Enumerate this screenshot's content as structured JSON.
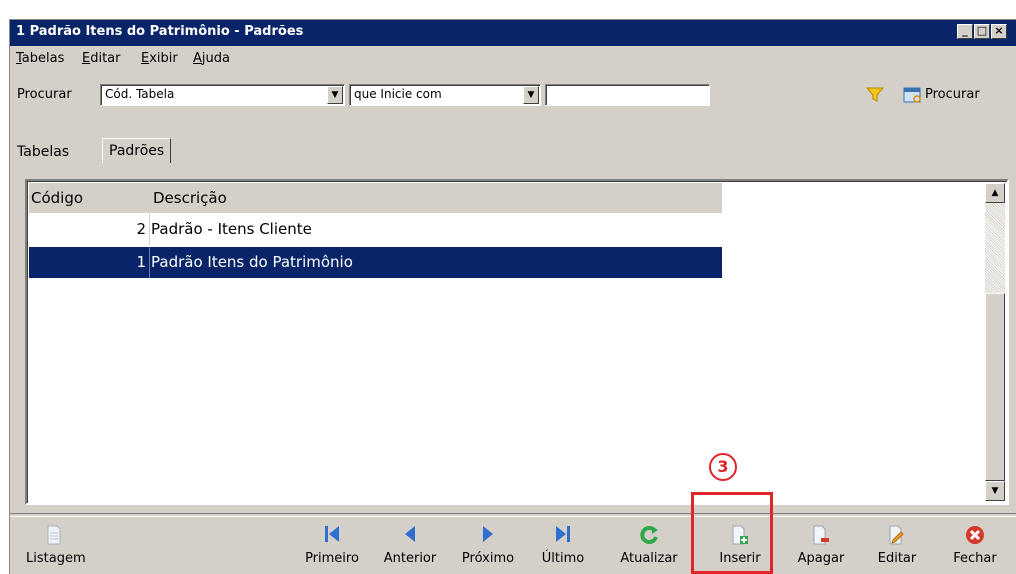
{
  "window": {
    "title": "1 Padrão Itens do Patrimônio - Padrões"
  },
  "menu": {
    "items": [
      "Tabelas",
      "Editar",
      "Exibir",
      "Ajuda"
    ]
  },
  "search": {
    "label": "Procurar",
    "field_value": "Cód. Tabela",
    "condition_value": "que Inicie com",
    "query_value": "",
    "filter_icon": "filter-icon",
    "button_label": "Procurar"
  },
  "tabs": [
    {
      "label": "Tabelas",
      "active": false
    },
    {
      "label": "Padrões",
      "active": true
    }
  ],
  "grid": {
    "columns": [
      "Código",
      "Descrição"
    ],
    "rows": [
      {
        "code": "2",
        "description": "Padrão - Itens Cliente",
        "selected": false
      },
      {
        "code": "1",
        "description": "Padrão Itens do Patrimônio",
        "selected": true
      }
    ]
  },
  "toolbar": {
    "listagem": "Listagem",
    "primeiro": "Primeiro",
    "anterior": "Anterior",
    "proximo": "Próximo",
    "ultimo": "Último",
    "atualizar": "Atualizar",
    "inserir": "Inserir",
    "apagar": "Apagar",
    "editar": "Editar",
    "fechar": "Fechar"
  },
  "annotation": {
    "step_marker": "3",
    "highlight_color": "#e0262a"
  },
  "colors": {
    "titlebar": "#0a246a",
    "selection": "#0a246a",
    "nav_blue": "#2f6fd0",
    "refresh_green": "#2ea84a",
    "close_red": "#d23a2a"
  }
}
